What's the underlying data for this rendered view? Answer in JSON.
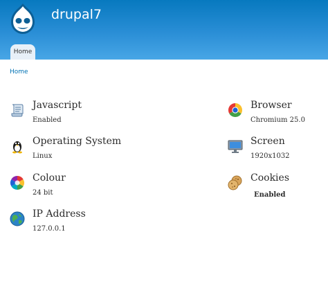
{
  "header": {
    "site_name": "drupal7",
    "tab_home": "Home"
  },
  "breadcrumb": {
    "home": "Home"
  },
  "info": {
    "javascript": {
      "title": "Javascript",
      "value": "Enabled",
      "icon": "scroll-icon"
    },
    "os": {
      "title": "Operating System",
      "value": "Linux",
      "icon": "linux-penguin-icon"
    },
    "colour": {
      "title": "Colour",
      "value": "24 bit",
      "icon": "color-wheel-icon"
    },
    "ip": {
      "title": "IP Address",
      "value": "127.0.0.1",
      "icon": "globe-icon"
    },
    "browser": {
      "title": "Browser",
      "value": "Chromium 25.0",
      "icon": "chrome-icon"
    },
    "screen": {
      "title": "Screen",
      "value": "1920x1032",
      "icon": "monitor-icon"
    },
    "cookies": {
      "title": "Cookies",
      "value": "Enabled",
      "icon": "cookies-icon"
    }
  },
  "colors": {
    "header_top": "#0779bf",
    "header_bottom": "#48a6e6",
    "link": "#0071b3"
  }
}
